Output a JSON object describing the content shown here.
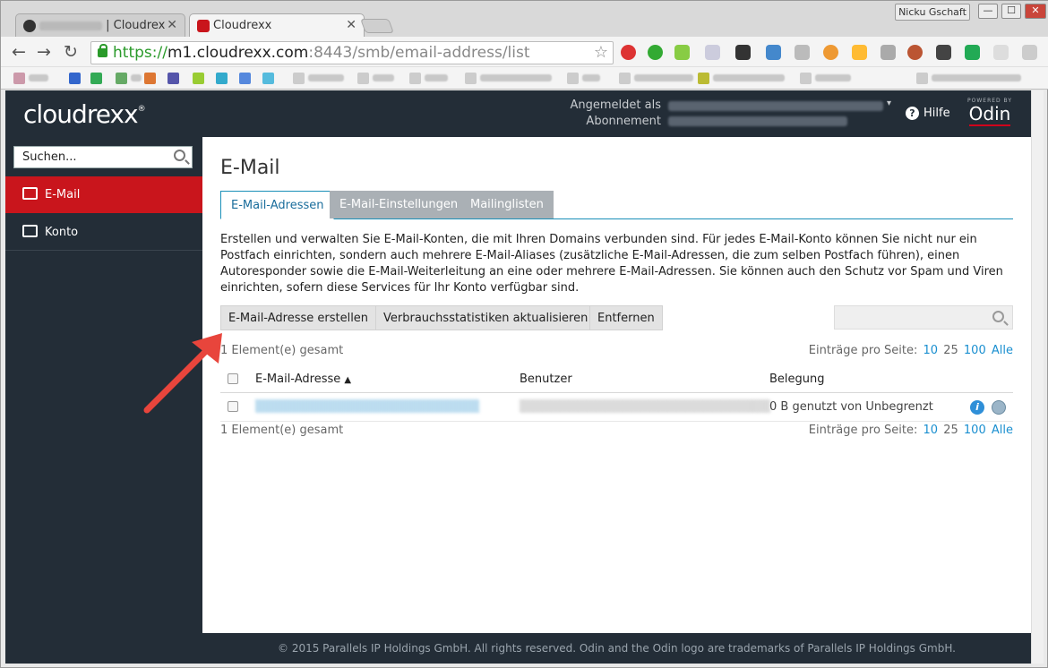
{
  "browser": {
    "tabs": [
      {
        "label": "| Cloudrex",
        "active": false
      },
      {
        "label": "Cloudrexx",
        "active": true
      }
    ],
    "profile_name": "Nicku Gschaft",
    "window_buttons": {
      "minimize": "—",
      "maximize": "☐",
      "close": "✕"
    },
    "url": {
      "scheme": "https://",
      "host": "m1.cloudrexx.com",
      "rest": ":8443/smb/email-address/list"
    },
    "nav_icons": [
      "back-icon",
      "forward-icon",
      "reload-icon",
      "star-icon"
    ]
  },
  "header": {
    "logo": "cloudrexx",
    "logo_mark": "®",
    "logged_in_label": "Angemeldet als",
    "subscription_label": "Abonnement",
    "help_label": "Hilfe",
    "brand_powered_by": "POWERED BY",
    "brand_name": "Odin"
  },
  "sidebar": {
    "search_placeholder": "Suchen...",
    "items": [
      {
        "label": "E-Mail",
        "active": true,
        "icon": "mail-icon"
      },
      {
        "label": "Konto",
        "active": false,
        "icon": "account-icon"
      }
    ]
  },
  "main": {
    "title": "E-Mail",
    "tabs": [
      {
        "label": "E-Mail-Adressen",
        "active": true
      },
      {
        "label": "E-Mail-Einstellungen",
        "active": false
      },
      {
        "label": "Mailinglisten",
        "active": false
      }
    ],
    "description": "Erstellen und verwalten Sie E-Mail-Konten, die mit Ihren Domains verbunden sind. Für jedes E-Mail-Konto können Sie nicht nur ein Postfach einrichten, sondern auch mehrere E-Mail-Aliases (zusätzliche E-Mail-Adressen, die zum selben Postfach führen), einen Autoresponder sowie die E-Mail-Weiterleitung an eine oder mehrere E-Mail-Adressen. Sie können auch den Schutz vor Spam und Viren einrichten, sofern diese Services für Ihr Konto verfügbar sind.",
    "buttons": {
      "create": "E-Mail-Adresse erstellen",
      "refresh_stats": "Verbrauchsstatistiken aktualisieren",
      "remove": "Entfernen"
    },
    "total_count": "1 Element(e) gesamt",
    "per_page": {
      "label": "Einträge pro Seite:",
      "options": [
        "10",
        "25",
        "100",
        "Alle"
      ],
      "selected": "25"
    },
    "table": {
      "columns": [
        "E-Mail-Adresse",
        "Benutzer",
        "Belegung"
      ],
      "sort_indicator": "▲",
      "rows": [
        {
          "usage": "0 B genutzt von Unbegrenzt"
        }
      ]
    }
  },
  "footer": {
    "text": "© 2015 Parallels IP Holdings GmbH. All rights reserved. Odin and the Odin logo are trademarks of Parallels IP Holdings GmbH."
  },
  "colors": {
    "header_bg": "#232d37",
    "accent_red": "#c9151c",
    "tab_border": "#1a8fb8",
    "link": "#1a8fd0",
    "annotation_arrow": "#e8453c"
  }
}
